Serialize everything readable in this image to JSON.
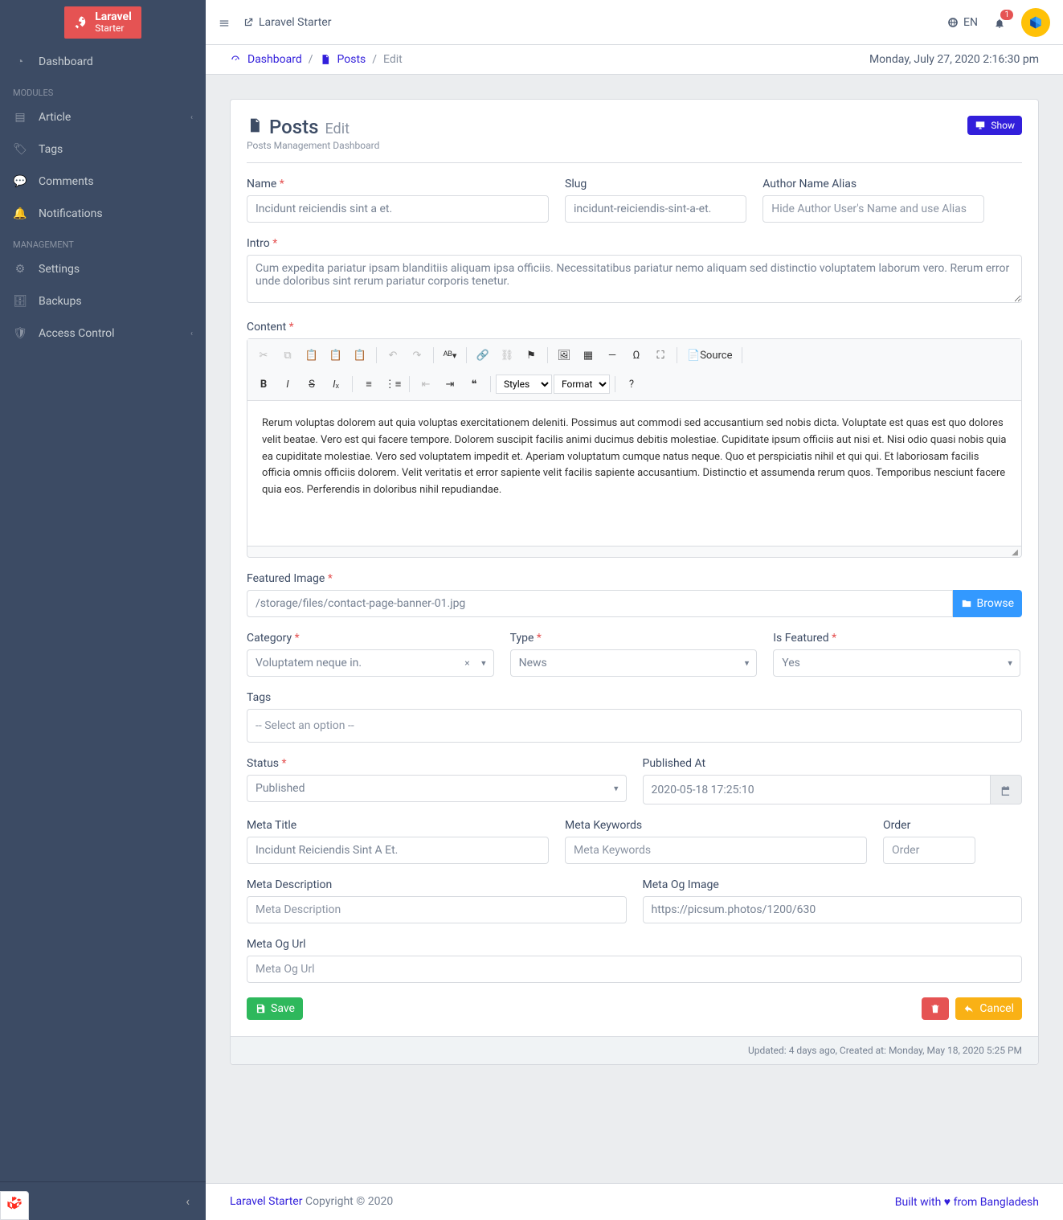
{
  "brand": {
    "line1": "Laravel",
    "line2": "Starter"
  },
  "header": {
    "app_name": "Laravel Starter",
    "lang": "EN",
    "notif_count": "1"
  },
  "sidebar": {
    "dashboard": "Dashboard",
    "section_modules": "MODULES",
    "article": "Article",
    "tags": "Tags",
    "comments": "Comments",
    "notifications": "Notifications",
    "section_management": "MANAGEMENT",
    "settings": "Settings",
    "backups": "Backups",
    "access_control": "Access Control"
  },
  "breadcrumb": {
    "dashboard": "Dashboard",
    "posts": "Posts",
    "edit": "Edit"
  },
  "datetime": "Monday, July 27, 2020 2:16:30 pm",
  "page": {
    "title": "Posts",
    "mode": "Edit",
    "subtitle": "Posts Management Dashboard",
    "show_btn": "Show"
  },
  "labels": {
    "name": "Name",
    "slug": "Slug",
    "author_alias": "Author Name Alias",
    "intro": "Intro",
    "content": "Content",
    "featured_image": "Featured Image",
    "category": "Category",
    "type": "Type",
    "is_featured": "Is Featured",
    "tags": "Tags",
    "status": "Status",
    "published_at": "Published At",
    "meta_title": "Meta Title",
    "meta_keywords": "Meta Keywords",
    "order": "Order",
    "meta_description": "Meta Description",
    "meta_og_image": "Meta Og Image",
    "meta_og_url": "Meta Og Url"
  },
  "placeholders": {
    "author_alias": "Hide Author User's Name and use Alias",
    "tags": "-- Select an option --",
    "meta_keywords": "Meta Keywords",
    "order": "Order",
    "meta_description": "Meta Description",
    "meta_og_url": "Meta Og Url"
  },
  "values": {
    "name": "Incidunt reiciendis sint a et.",
    "slug": "incidunt-reiciendis-sint-a-et.",
    "intro": "Cum expedita pariatur ipsam blanditiis aliquam ipsa officiis. Necessitatibus pariatur nemo aliquam sed distinctio voluptatem laborum vero. Rerum error unde doloribus sint rerum pariatur corporis tenetur.",
    "content": "Rerum voluptas dolorem aut quia voluptas exercitationem deleniti. Possimus aut commodi sed accusantium sed nobis dicta. Voluptate est quas est quo dolores velit beatae. Vero est qui facere tempore. Dolorem suscipit facilis animi ducimus debitis molestiae. Cupiditate ipsum officiis aut nisi et. Nisi odio quasi nobis quia ea cupiditate molestiae. Vero sed voluptatem impedit et. Aperiam voluptatum cumque natus neque. Quo et perspiciatis nihil et qui qui. Et laboriosam facilis officia omnis officiis dolorem. Velit veritatis et error sapiente velit facilis sapiente accusantium. Distinctio et assumenda rerum quos. Temporibus nesciunt facere quia eos. Perferendis in doloribus nihil repudiandae.",
    "featured_image": "/storage/files/contact-page-banner-01.jpg",
    "category": "Voluptatem neque in.",
    "type": "News",
    "is_featured": "Yes",
    "status": "Published",
    "published_at": "2020-05-18 17:25:10",
    "meta_title": "Incidunt Reiciendis Sint A Et.",
    "meta_og_image": "https://picsum.photos/1200/630"
  },
  "editor": {
    "styles": "Styles",
    "format": "Format",
    "source": "Source"
  },
  "buttons": {
    "browse": "Browse",
    "save": "Save",
    "cancel": "Cancel"
  },
  "card_footer": "Updated: 4 days ago, Created at: Monday, May 18, 2020 5:25 PM",
  "footer": {
    "left_link": "Laravel Starter",
    "left_text": " Copyright © 2020",
    "right": "Built with ♥ from Bangladesh"
  }
}
